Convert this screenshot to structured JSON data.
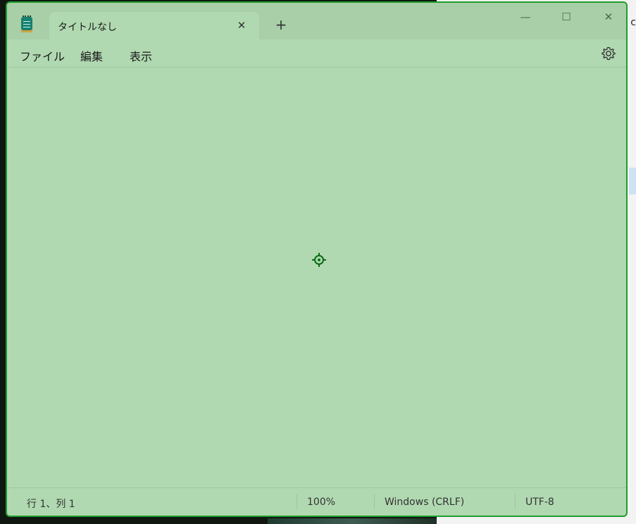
{
  "window": {
    "tab_title": "タイトルなし",
    "close_tab_glyph": "✕",
    "new_tab_glyph": "+",
    "minimize_glyph": "—",
    "maximize_glyph": "☐",
    "close_glyph": "✕"
  },
  "menu": {
    "file": "ファイル",
    "edit": "編集",
    "view": "表示"
  },
  "editor": {
    "content": ""
  },
  "status": {
    "position": "行 1、列 1",
    "zoom": "100%",
    "line_ending": "Windows (CRLF)",
    "encoding": "UTF-8"
  },
  "background": {
    "edge_text": "c"
  },
  "icons": {
    "app": "notepad-icon",
    "settings": "gear-icon",
    "cursor": "crosshair-target-icon"
  },
  "colors": {
    "window_tint": "#b1d9b1",
    "window_border": "#1f9d2b",
    "cursor": "#0a6a16"
  }
}
